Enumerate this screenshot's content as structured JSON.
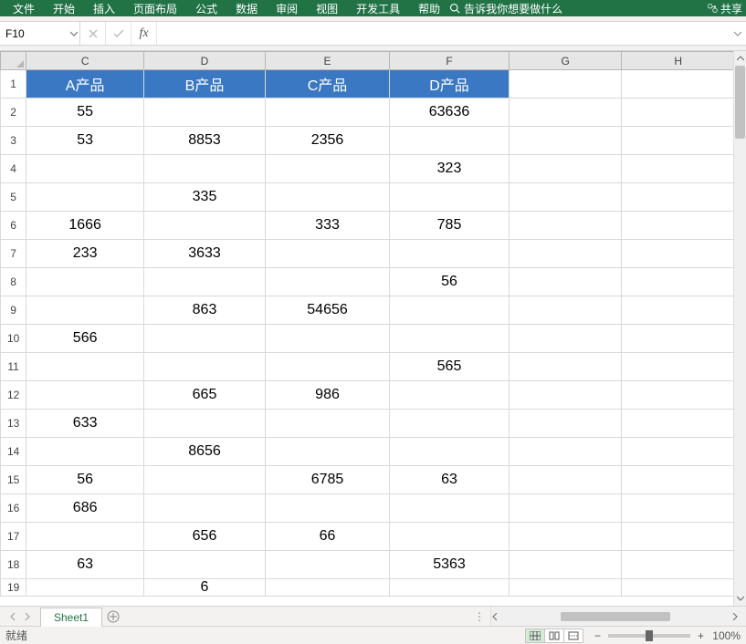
{
  "ribbon": {
    "tabs": [
      "文件",
      "开始",
      "插入",
      "页面布局",
      "公式",
      "数据",
      "审阅",
      "视图",
      "开发工具",
      "帮助"
    ],
    "tell_me": "告诉我你想要做什么",
    "share": "共享"
  },
  "name_box": {
    "value": "F10"
  },
  "formula_bar": {
    "value": ""
  },
  "columns": [
    "C",
    "D",
    "E",
    "F",
    "G",
    "H"
  ],
  "header_row": {
    "C": "A产品",
    "D": "B产品",
    "E": "C产品",
    "F": "D产品"
  },
  "rows": [
    {
      "n": "2",
      "C": "55",
      "D": "",
      "E": "",
      "F": "63636"
    },
    {
      "n": "3",
      "C": "53",
      "D": "8853",
      "E": "2356",
      "F": ""
    },
    {
      "n": "4",
      "C": "",
      "D": "",
      "E": "",
      "F": "323"
    },
    {
      "n": "5",
      "C": "",
      "D": "335",
      "E": "",
      "F": ""
    },
    {
      "n": "6",
      "C": "1666",
      "D": "",
      "E": "333",
      "F": "785"
    },
    {
      "n": "7",
      "C": "233",
      "D": "3633",
      "E": "",
      "F": ""
    },
    {
      "n": "8",
      "C": "",
      "D": "",
      "E": "",
      "F": "56"
    },
    {
      "n": "9",
      "C": "",
      "D": "863",
      "E": "54656",
      "F": ""
    },
    {
      "n": "10",
      "C": "566",
      "D": "",
      "E": "",
      "F": ""
    },
    {
      "n": "11",
      "C": "",
      "D": "",
      "E": "",
      "F": "565"
    },
    {
      "n": "12",
      "C": "",
      "D": "665",
      "E": "986",
      "F": ""
    },
    {
      "n": "13",
      "C": "633",
      "D": "",
      "E": "",
      "F": ""
    },
    {
      "n": "14",
      "C": "",
      "D": "8656",
      "E": "",
      "F": ""
    },
    {
      "n": "15",
      "C": "56",
      "D": "",
      "E": "6785",
      "F": "63"
    },
    {
      "n": "16",
      "C": "686",
      "D": "",
      "E": "",
      "F": ""
    },
    {
      "n": "17",
      "C": "",
      "D": "656",
      "E": "66",
      "F": ""
    },
    {
      "n": "18",
      "C": "63",
      "D": "",
      "E": "",
      "F": "5363"
    },
    {
      "n": "19",
      "C": "",
      "D": "6",
      "E": "",
      "F": ""
    }
  ],
  "sheet_tab": "Sheet1",
  "status": {
    "ready": "就绪",
    "zoom": "100%"
  },
  "chart_data": {
    "type": "table",
    "title": "",
    "categories": [
      "A产品",
      "B产品",
      "C产品",
      "D产品"
    ],
    "series": [
      {
        "name": "row2",
        "values": [
          55,
          null,
          null,
          63636
        ]
      },
      {
        "name": "row3",
        "values": [
          53,
          8853,
          2356,
          null
        ]
      },
      {
        "name": "row4",
        "values": [
          null,
          null,
          null,
          323
        ]
      },
      {
        "name": "row5",
        "values": [
          null,
          335,
          null,
          null
        ]
      },
      {
        "name": "row6",
        "values": [
          1666,
          null,
          333,
          785
        ]
      },
      {
        "name": "row7",
        "values": [
          233,
          3633,
          null,
          null
        ]
      },
      {
        "name": "row8",
        "values": [
          null,
          null,
          null,
          56
        ]
      },
      {
        "name": "row9",
        "values": [
          null,
          863,
          54656,
          null
        ]
      },
      {
        "name": "row10",
        "values": [
          566,
          null,
          null,
          null
        ]
      },
      {
        "name": "row11",
        "values": [
          null,
          null,
          null,
          565
        ]
      },
      {
        "name": "row12",
        "values": [
          null,
          665,
          986,
          null
        ]
      },
      {
        "name": "row13",
        "values": [
          633,
          null,
          null,
          null
        ]
      },
      {
        "name": "row14",
        "values": [
          null,
          8656,
          null,
          null
        ]
      },
      {
        "name": "row15",
        "values": [
          56,
          null,
          6785,
          63
        ]
      },
      {
        "name": "row16",
        "values": [
          686,
          null,
          null,
          null
        ]
      },
      {
        "name": "row17",
        "values": [
          null,
          656,
          66,
          null
        ]
      },
      {
        "name": "row18",
        "values": [
          63,
          null,
          null,
          5363
        ]
      },
      {
        "name": "row19",
        "values": [
          null,
          6,
          null,
          null
        ]
      }
    ]
  }
}
